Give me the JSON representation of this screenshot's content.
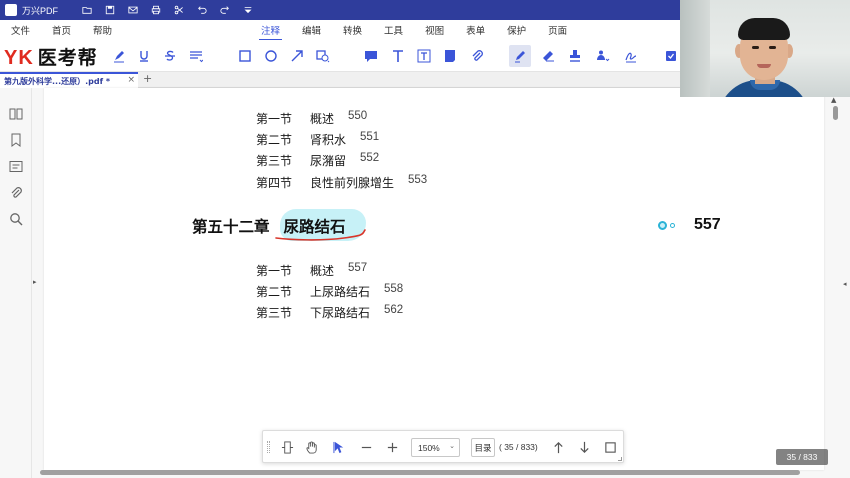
{
  "window": {
    "app_title": "万兴PDF"
  },
  "menu": {
    "left": [
      "文件",
      "首页",
      "帮助"
    ],
    "tabs": [
      {
        "label": "注释",
        "active": true
      },
      {
        "label": "编辑",
        "active": false
      },
      {
        "label": "转换",
        "active": false
      },
      {
        "label": "工具",
        "active": false
      },
      {
        "label": "视图",
        "active": false
      },
      {
        "label": "表单",
        "active": false
      },
      {
        "label": "保护",
        "active": false
      },
      {
        "label": "页面",
        "active": false
      }
    ]
  },
  "brand": {
    "yk": "YK",
    "name": "医考帮"
  },
  "document_tab": {
    "name": "第九版外科学...还原）.pdf *",
    "close": "×",
    "add": "+"
  },
  "toc": {
    "upper": [
      {
        "section": "第一节",
        "title": "概述",
        "page": "550"
      },
      {
        "section": "第二节",
        "title": "肾积水",
        "page": "551"
      },
      {
        "section": "第三节",
        "title": "尿潴留",
        "page": "552"
      },
      {
        "section": "第四节",
        "title": "良性前列腺增生",
        "page": "553"
      }
    ],
    "chapter": {
      "number": "第五十二章",
      "title": "尿路结石",
      "page": "557"
    },
    "lower": [
      {
        "section": "第一节",
        "title": "概述",
        "page": "557"
      },
      {
        "section": "第二节",
        "title": "上尿路结石",
        "page": "558"
      },
      {
        "section": "第三节",
        "title": "下尿路结石",
        "page": "562"
      }
    ]
  },
  "bottom_toolbar": {
    "zoom": "150%",
    "toc_label": "目录",
    "page_info": "( 35 / 833)"
  },
  "page_badge": "35 / 833",
  "colors": {
    "title_bar": "#2f3d9c",
    "accent": "#3b55d8",
    "brand_red": "#e02b20",
    "highlight": "#bdeef6",
    "pen_annotation": "#d9362b"
  }
}
